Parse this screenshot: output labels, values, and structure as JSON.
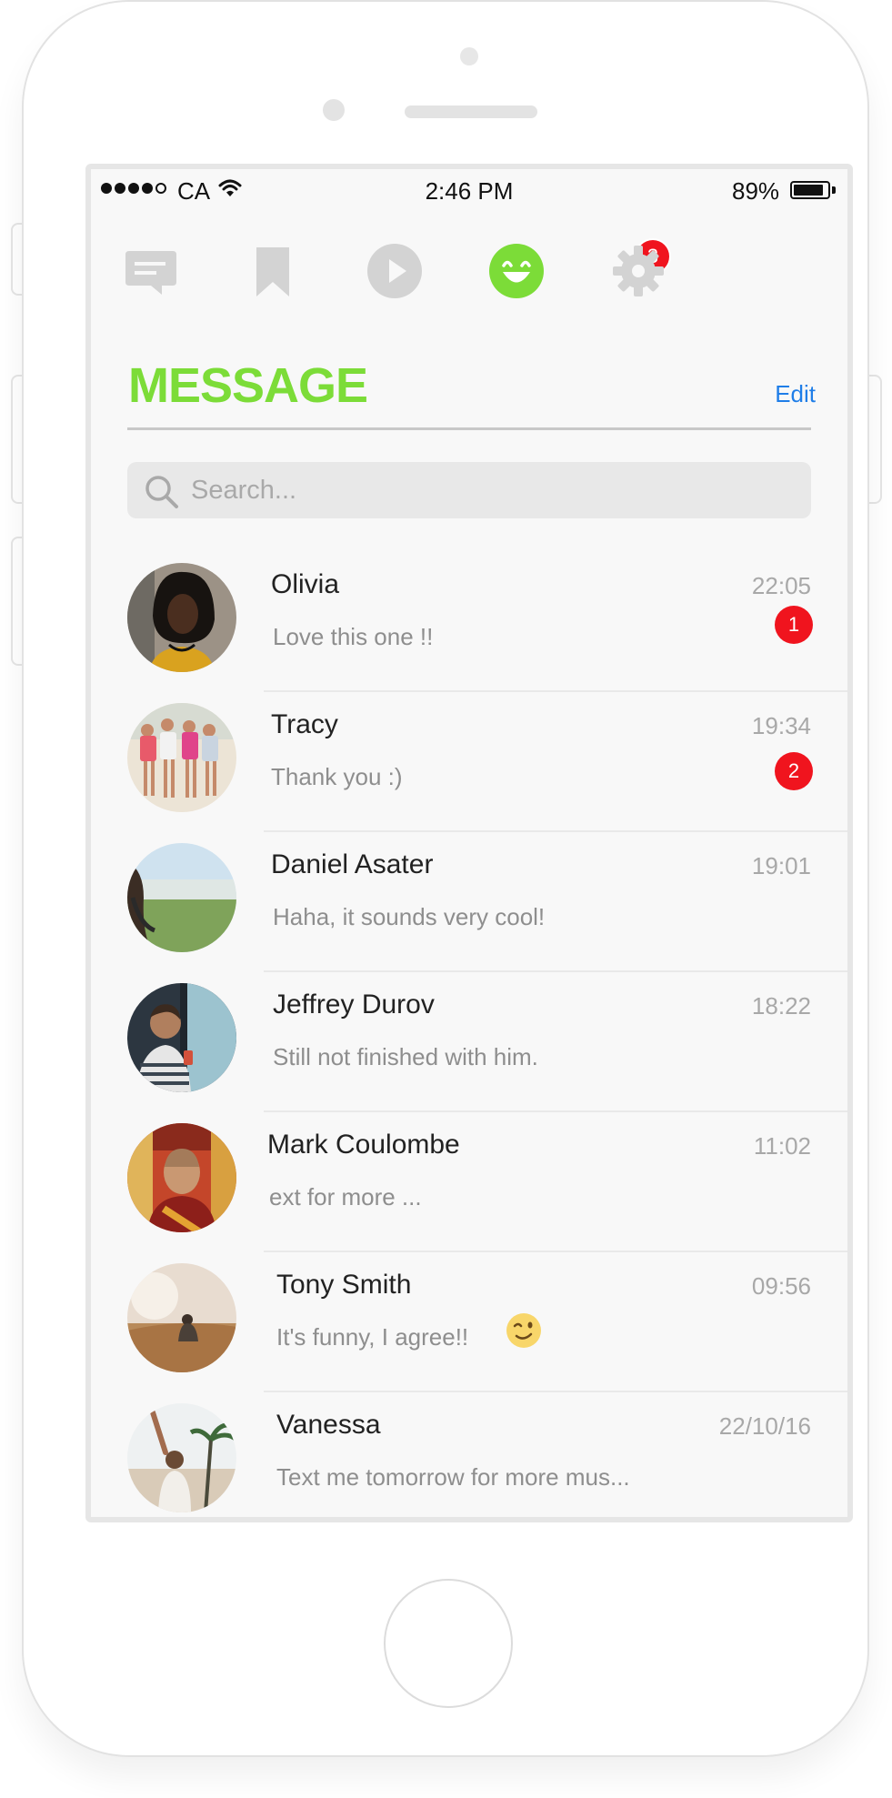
{
  "status_bar": {
    "carrier": "CA",
    "time": "2:46 PM",
    "battery": "89%",
    "battery_level": 0.89
  },
  "tabs": [
    {
      "name": "messages",
      "icon": "chat-bubble-icon"
    },
    {
      "name": "bookmarks",
      "icon": "bookmark-icon"
    },
    {
      "name": "videos",
      "icon": "play-icon"
    },
    {
      "name": "friends",
      "icon": "smiley-face-icon",
      "badge": "3",
      "active": true
    },
    {
      "name": "settings",
      "icon": "gear-icon"
    }
  ],
  "colors": {
    "accent": "#7cdc38",
    "link": "#1f7ee8",
    "badge": "#f0141e",
    "inactive_icon": "#d3d3d3"
  },
  "header": {
    "title": "MESSAGE",
    "edit_label": "Edit"
  },
  "search": {
    "placeholder": "Search...",
    "value": ""
  },
  "conversations": [
    {
      "name": "Olivia",
      "time": "22:05",
      "preview": "Love this one !!",
      "unread": "1"
    },
    {
      "name": "Tracy",
      "time": "19:34",
      "preview": "Thank you :)",
      "unread": "2"
    },
    {
      "name": "Daniel Asater",
      "time": "19:01",
      "preview": "Haha, it sounds very cool!"
    },
    {
      "name": "Jeffrey Durov",
      "time": "18:22",
      "preview": "Still not finished with him."
    },
    {
      "name": "Mark Coulombe",
      "time": "11:02",
      "preview": "ext for more ..."
    },
    {
      "name": "Tony Smith",
      "time": "09:56",
      "preview": "It's funny, I agree!!",
      "emoji": "winking-face-icon"
    },
    {
      "name": "Vanessa",
      "time": "22/10/16",
      "preview": "Text me tomorrow for more mus..."
    }
  ]
}
